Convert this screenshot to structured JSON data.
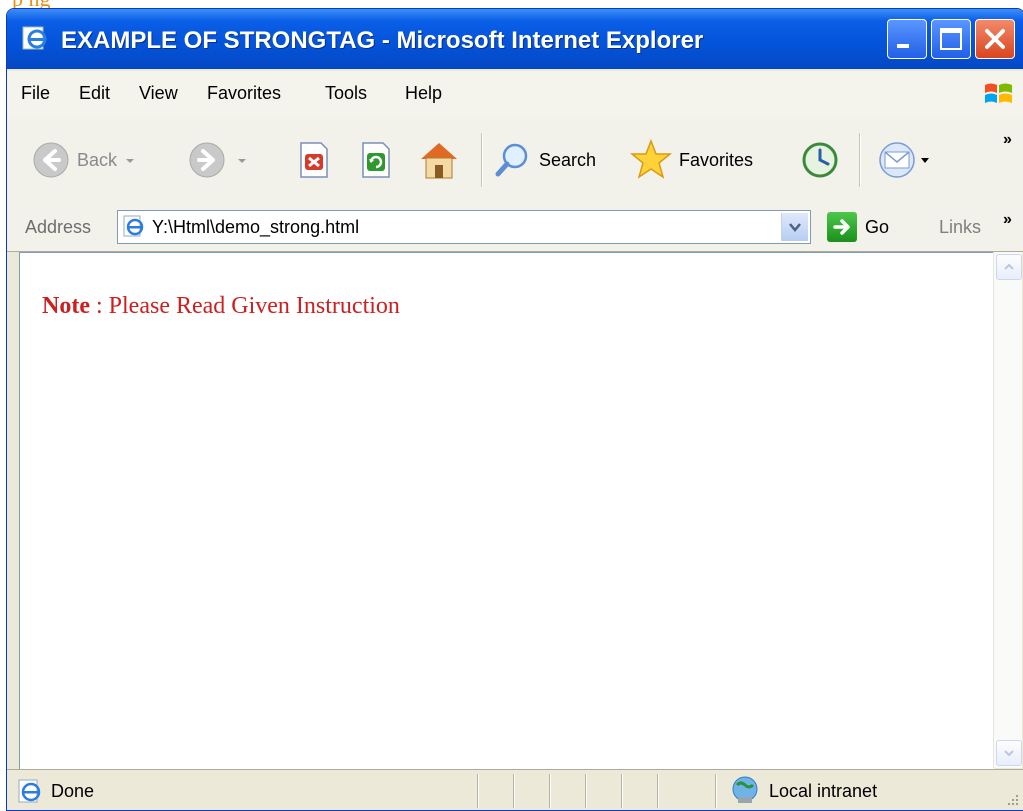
{
  "fragment": {
    "text": "p  ng"
  },
  "window": {
    "title": "EXAMPLE OF STRONGTAG - Microsoft Internet Explorer",
    "menu": [
      "File",
      "Edit",
      "View",
      "Favorites",
      "Tools",
      "Help"
    ]
  },
  "toolbar": {
    "back_label": "Back",
    "search_label": "Search",
    "favorites_label": "Favorites",
    "overflow": "»"
  },
  "address": {
    "label": "Address",
    "url": "Y:\\Html\\demo_strong.html",
    "go_label": "Go",
    "links_label": "Links",
    "links_overflow": "»"
  },
  "page": {
    "note_strong": "Note",
    "note_text": " : Please Read Given Instruction"
  },
  "status": {
    "text": "Done",
    "zone": "Local intranet"
  },
  "colors": {
    "titlebar": "#0453d9",
    "note_red": "#cc1f1f",
    "chrome": "#ece9d8"
  },
  "icons": [
    "ie-page-icon",
    "minimize-icon",
    "maximize-icon",
    "close-icon",
    "windows-flag-icon",
    "back-arrow-icon",
    "forward-arrow-icon",
    "stop-icon",
    "refresh-icon",
    "home-icon",
    "search-icon",
    "favorites-star-icon",
    "history-icon",
    "mail-icon",
    "go-arrow-icon",
    "intranet-icon",
    "resize-grip-icon"
  ]
}
